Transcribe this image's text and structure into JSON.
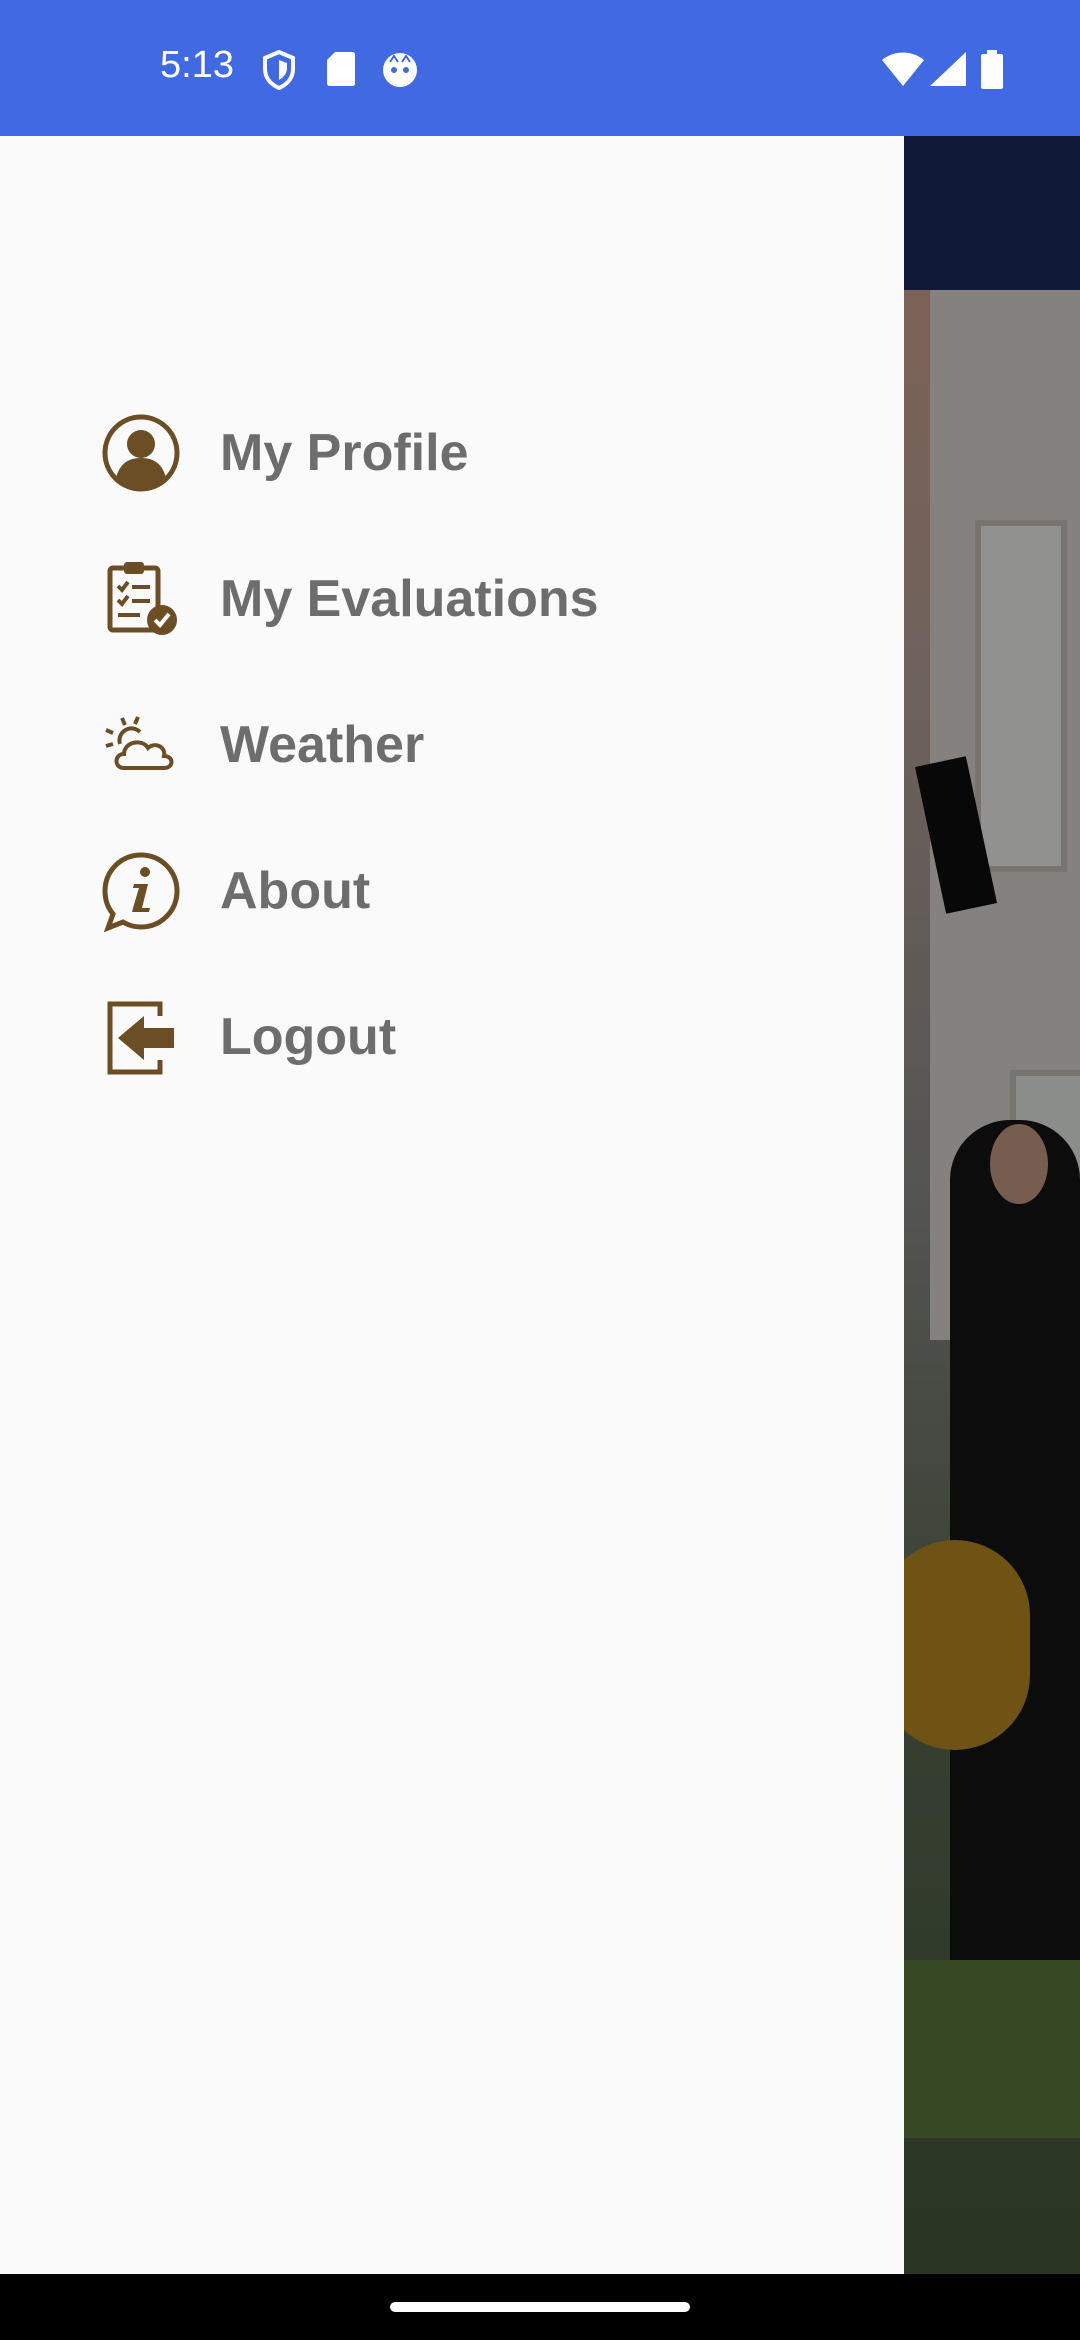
{
  "status_bar": {
    "time": "5:13",
    "left_icons": [
      "shield-icon",
      "sd-card-icon",
      "face-icon"
    ],
    "right_icons": [
      "wifi-icon",
      "signal-icon",
      "battery-icon"
    ],
    "color": "#4169e1"
  },
  "drawer": {
    "icon_color": "#6b4e26",
    "text_color": "#6d6d6d",
    "items": [
      {
        "label": "My Profile",
        "icon": "profile-icon"
      },
      {
        "label": "My Evaluations",
        "icon": "clipboard-check-icon"
      },
      {
        "label": "Weather",
        "icon": "sun-cloud-icon"
      },
      {
        "label": "About",
        "icon": "info-icon"
      },
      {
        "label": "Logout",
        "icon": "logout-icon"
      }
    ]
  }
}
